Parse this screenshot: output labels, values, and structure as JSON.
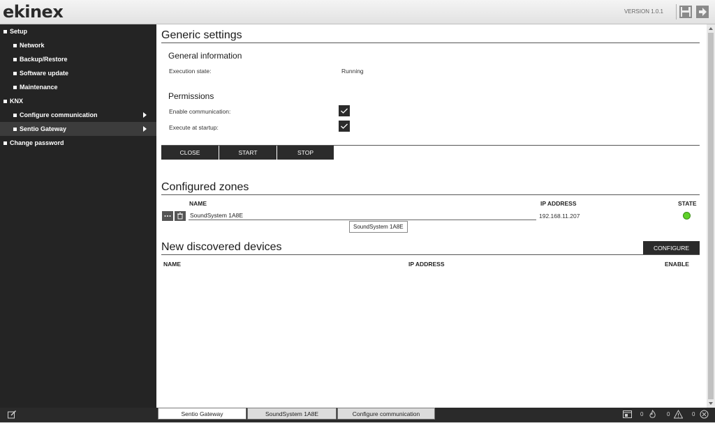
{
  "header": {
    "logo": "ekinex",
    "version": "VERSION 1.0.1",
    "icons": [
      "save-icon",
      "exit-icon"
    ]
  },
  "sidebar": {
    "items": [
      {
        "label": "Setup",
        "level": 0
      },
      {
        "label": "Network",
        "level": 1
      },
      {
        "label": "Backup/Restore",
        "level": 1
      },
      {
        "label": "Software update",
        "level": 1
      },
      {
        "label": "Maintenance",
        "level": 1
      },
      {
        "label": "KNX",
        "level": 0
      },
      {
        "label": "Configure communication",
        "level": 1,
        "has_submenu": true
      },
      {
        "label": "Sentio Gateway",
        "level": 1,
        "has_submenu": true,
        "active": true
      },
      {
        "label": "Change password",
        "level": 0
      }
    ]
  },
  "generic": {
    "title": "Generic settings",
    "info_title": "General information",
    "exec_label": "Execution state:",
    "exec_value": "Running",
    "perm_title": "Permissions",
    "enable_comm_label": "Enable communication:",
    "enable_comm_checked": true,
    "exec_startup_label": "Execute at startup:",
    "exec_startup_checked": true,
    "buttons": {
      "close": "CLOSE",
      "start": "START",
      "stop": "STOP"
    }
  },
  "zones": {
    "title": "Configured zones",
    "col_name": "NAME",
    "col_ip": "IP ADDRESS",
    "col_state": "STATE",
    "rows": [
      {
        "name": "SoundSystem 1A8E",
        "ip": "192.168.11.207",
        "state": "online",
        "tooltip": "SoundSystem 1A8E"
      }
    ]
  },
  "discovered": {
    "title": "New discovered devices",
    "configure_button": "CONFIGURE",
    "col_name": "NAME",
    "col_ip": "IP ADDRESS",
    "col_enable": "ENABLE"
  },
  "footer": {
    "tabs": [
      {
        "label": "Sentio Gateway",
        "active": true
      },
      {
        "label": "SoundSystem 1A8E",
        "active": false
      },
      {
        "label": "Configure communication",
        "active": false
      }
    ],
    "counts": {
      "info": "0",
      "fire": "0",
      "warning": "0",
      "error": "0"
    }
  },
  "colors": {
    "accent_dark": "#2b2b2b",
    "sidebar_bg": "#242424",
    "led_green": "#5fd12a"
  }
}
